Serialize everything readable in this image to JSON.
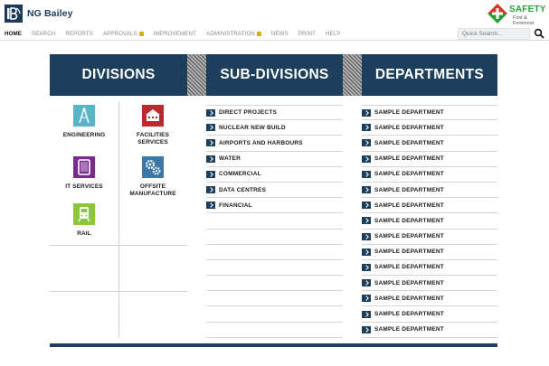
{
  "header": {
    "logo_text": "NG Bailey",
    "safety_title": "SAFETY",
    "safety_subtitle": "First & Foremost"
  },
  "nav": {
    "items": [
      {
        "label": "HOME",
        "active": true,
        "locked": false
      },
      {
        "label": "SEARCH",
        "active": false,
        "locked": false
      },
      {
        "label": "REPORTS",
        "active": false,
        "locked": false
      },
      {
        "label": "APPROVALS",
        "active": false,
        "locked": true
      },
      {
        "label": "IMPROVEMENT",
        "active": false,
        "locked": false
      },
      {
        "label": "ADMINISTRATION",
        "active": false,
        "locked": true
      },
      {
        "label": "NEWS",
        "active": false,
        "locked": false
      },
      {
        "label": "PRINT",
        "active": false,
        "locked": false
      },
      {
        "label": "HELP",
        "active": false,
        "locked": false
      }
    ],
    "search_placeholder": "Quick Search..."
  },
  "columns": {
    "divisions": "DIVISIONS",
    "subdivisions": "SUB-DIVISIONS",
    "departments": "DEPARTMENTS"
  },
  "divisions": [
    {
      "label_lines": [
        "ENGINEERING"
      ],
      "icon": "compass-icon",
      "color": "#5ab4c8"
    },
    {
      "label_lines": [
        "FACILITIES",
        "SERVICES"
      ],
      "icon": "building-icon",
      "color": "#c0262d"
    },
    {
      "label_lines": [
        "IT SERVICES"
      ],
      "icon": "tablet-icon",
      "color": "#7a2c8e"
    },
    {
      "label_lines": [
        "OFFSITE",
        "MANUFACTURE"
      ],
      "icon": "gears-icon",
      "color": "#3b78a8"
    },
    {
      "label_lines": [
        "RAIL"
      ],
      "icon": "train-icon",
      "color": "#8cc63f"
    }
  ],
  "subdivisions": [
    "DIRECT PROJECTS",
    "NUCLEAR NEW BUILD",
    "AIRPORTS AND HARBOURS",
    "WATER",
    "COMMERCIAL",
    "DATA CENTRES",
    "FINANCIAL",
    "",
    "",
    "",
    "",
    "",
    "",
    "",
    ""
  ],
  "departments": [
    "SAMPLE DEPARTMENT",
    "SAMPLE DEPARTMENT",
    "SAMPLE DEPARTMENT",
    "SAMPLE DEPARTMENT",
    "SAMPLE DEPARTMENT",
    "SAMPLE DEPARTMENT",
    "SAMPLE DEPARTMENT",
    "SAMPLE DEPARTMENT",
    "SAMPLE DEPARTMENT",
    "SAMPLE DEPARTMENT",
    "SAMPLE DEPARTMENT",
    "SAMPLE DEPARTMENT",
    "SAMPLE DEPARTMENT",
    "SAMPLE DEPARTMENT",
    "SAMPLE DEPARTMENT"
  ],
  "colors": {
    "header_navy": "#1d3f5c",
    "safety_green": "#2a9d3a",
    "safety_red": "#d9362b",
    "lock_amber": "#e0a800"
  }
}
